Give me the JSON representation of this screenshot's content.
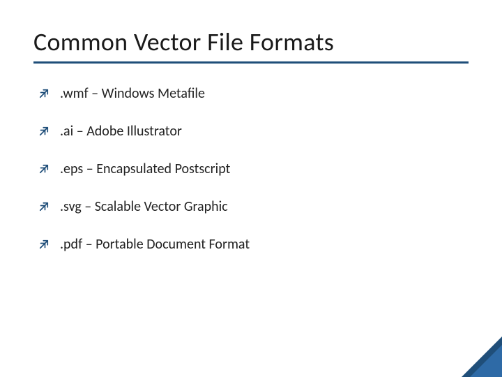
{
  "title": "Common Vector File Formats",
  "items": [
    ".wmf – Windows Metafile",
    ".ai – Adobe Illustrator",
    ".eps – Encapsulated Postscript",
    ".svg – Scalable Vector Graphic",
    ".pdf – Portable Document Format"
  ]
}
